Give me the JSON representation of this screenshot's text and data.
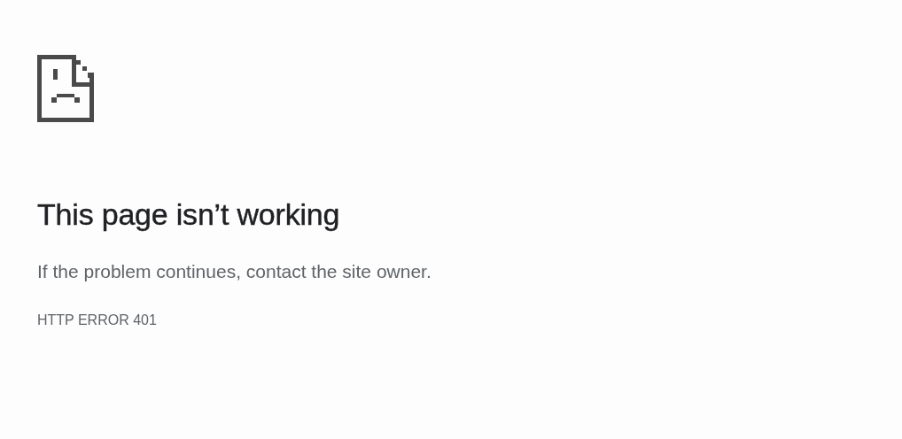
{
  "heading": "This page isn’t working",
  "message": "If the problem continues, contact the site owner.",
  "error_code": "HTTP ERROR 401"
}
